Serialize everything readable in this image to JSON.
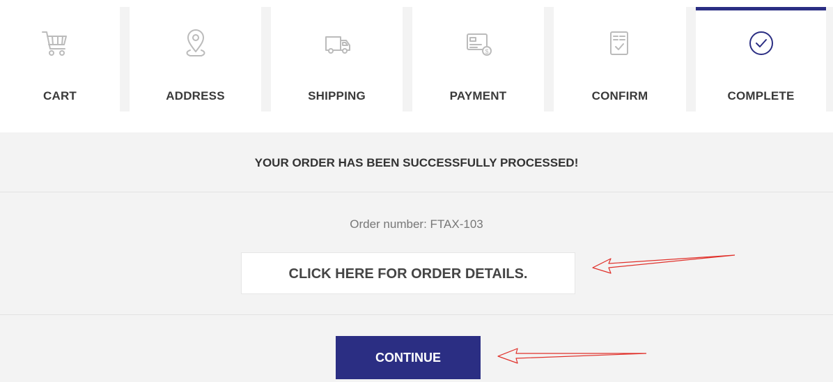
{
  "steps": [
    {
      "label": "CART",
      "icon": "cart-icon"
    },
    {
      "label": "ADDRESS",
      "icon": "location-pin-icon"
    },
    {
      "label": "SHIPPING",
      "icon": "truck-icon"
    },
    {
      "label": "PAYMENT",
      "icon": "payment-card-icon"
    },
    {
      "label": "CONFIRM",
      "icon": "clipboard-check-icon"
    },
    {
      "label": "COMPLETE",
      "icon": "check-circle-icon"
    }
  ],
  "active_step": "COMPLETE",
  "colors": {
    "accent": "#2b2e83",
    "icon_inactive": "#bbbbbb",
    "annotation": "#e0302a"
  },
  "confirmation": {
    "title": "YOUR ORDER HAS BEEN SUCCESSFULLY PROCESSED!",
    "order_number": "Order number: FTAX-103",
    "details_link": "CLICK HERE FOR ORDER DETAILS.",
    "continue_label": "CONTINUE"
  }
}
